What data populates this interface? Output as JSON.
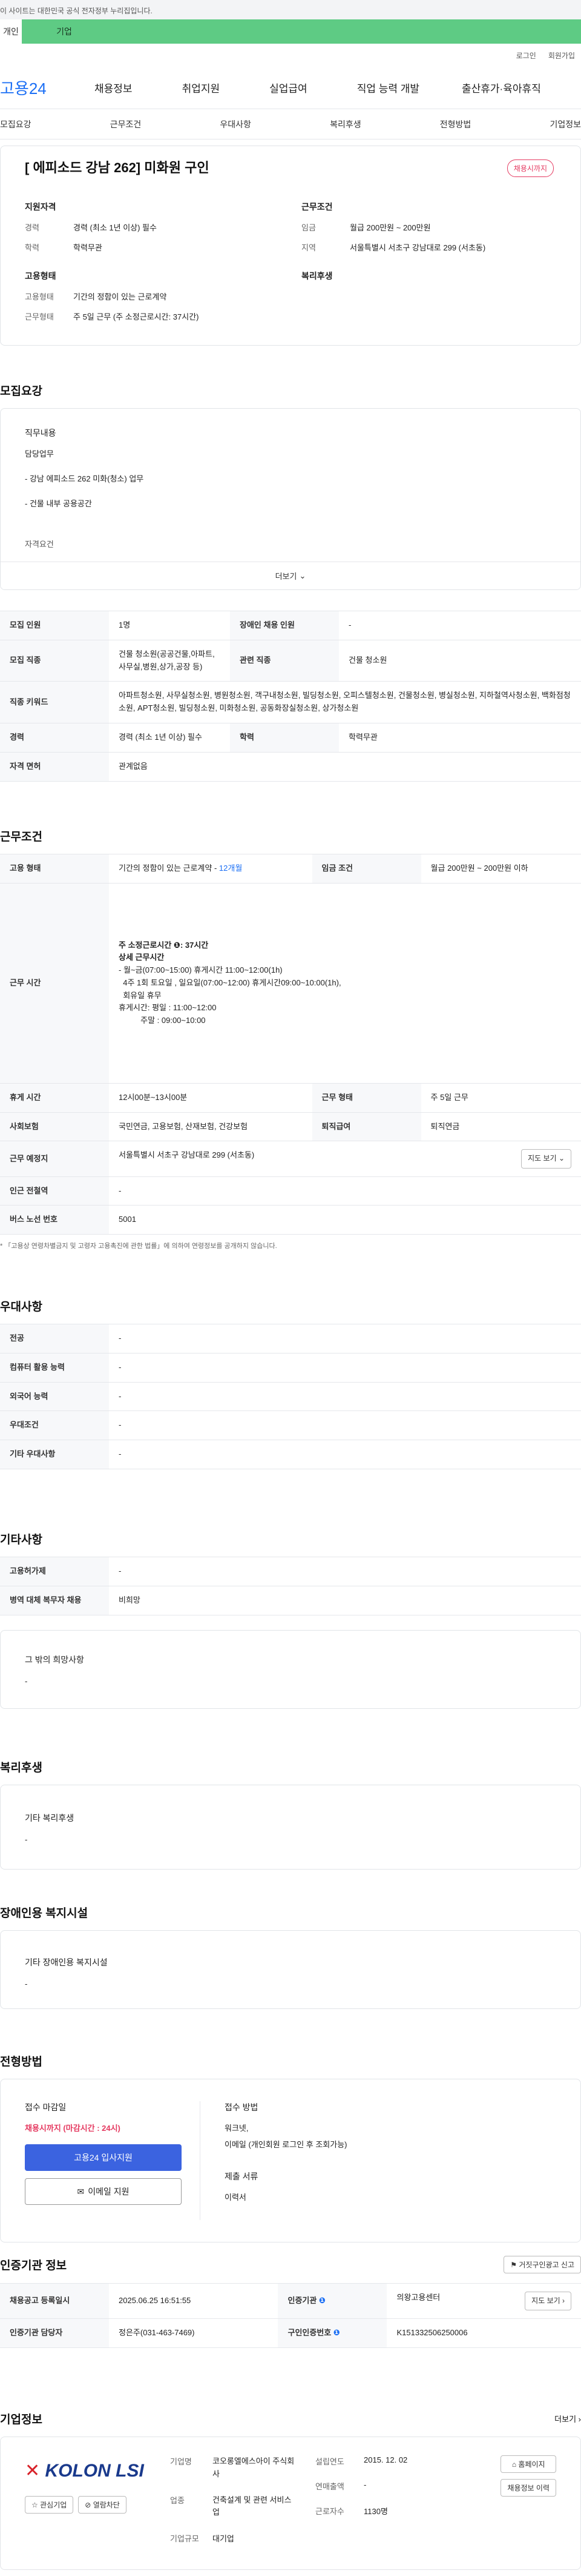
{
  "notice": "이 사이트는 대한민국 공식 전자정부 누리집입니다.",
  "tabs": [
    "개인",
    "기업"
  ],
  "util": [
    "로그인",
    "회원가입"
  ],
  "logo": "고용24",
  "gnb": [
    "채용정보",
    "취업지원",
    "실업급여",
    "직업 능력 개발",
    "출산휴가·육아휴직"
  ],
  "subnav": [
    "모집요강",
    "근무조건",
    "우대사항",
    "복리후생",
    "전형방법",
    "기업정보"
  ],
  "header": {
    "title": "[ 에피소드 강남 262] 미화원 구인",
    "badge": "채용시까지",
    "qual_title": "지원자격",
    "qual": [
      {
        "k": "경력",
        "v": "경력 (최소 1년 이상) 필수"
      },
      {
        "k": "학력",
        "v": "학력무관"
      }
    ],
    "cond_title": "근무조건",
    "cond": [
      {
        "k": "임금",
        "v": "월급 200만원 ~ 200만원"
      },
      {
        "k": "지역",
        "v": "서울특별시 서초구 강남대로 299 (서초동)"
      }
    ],
    "emp_title": "고용형태",
    "emp": [
      {
        "k": "고용형태",
        "v": "기간의 정함이 있는 근로계약"
      },
      {
        "k": "근무형태",
        "v": "주 5일 근무 (주 소정근로시간: 37시간)"
      }
    ],
    "welfare_title": "복리후생"
  },
  "recruit": {
    "title": "모집요강",
    "duty_title": "직무내용",
    "duty_sub": "담당업무",
    "duty_lines": [
      "- 강남 에피소드 262 미화(청소) 업무",
      "- 건물 내부 공용공간"
    ],
    "qual_cut": "자격요건",
    "more": "더보기",
    "rows": [
      {
        "k1": "모집 인원",
        "v1": "1명",
        "k2": "장애인 채용 인원",
        "v2": "-"
      },
      {
        "k1": "모집 직종",
        "v1": "건물 청소원(공공건물,아파트,사무실,병원,상가,공장 등)",
        "k2": "관련 직종",
        "v2": "건물 청소원"
      },
      {
        "k1": "직종 키워드",
        "v1": "아파트청소원, 사무실청소원, 병원청소원, 객구내청소원, 빌딩청소원, 오피스텔청소원, 건물청소원, 병실청소원, 지하철역사청소원, 백화점청소원, APT청소원, 빌딩청소원, 미화청소원, 공동화장실청소원, 상가청소원"
      },
      {
        "k1": "경력",
        "v1": "경력 (최소 1년 이상) 필수",
        "k2": "학력",
        "v2": "학력무관"
      },
      {
        "k1": "자격 면허",
        "v1": "관계없음"
      }
    ]
  },
  "work": {
    "title": "근무조건",
    "rows": [
      {
        "k1": "고용 형태",
        "v1": "기간의 정함이 있는 근로계약 - ",
        "v1b": "12개월",
        "k2": "임금 조건",
        "v2": "월급 200만원 ~ 200만원 이하"
      },
      {
        "k1": "근무 시간",
        "lines": [
          "주 소정근로시간 ❶: 37시간",
          "",
          "상세 근무시간",
          "- 월~금(07:00~15:00) 휴게시간 11:00~12:00(1h)",
          "  4주 1회 토요일 , 일요일(07:00~12:00) 휴게시간09:00~10:00(1h),",
          "  회유일 휴무",
          "",
          "휴게시간: 평일 : 11:00~12:00",
          "          주말 : 09:00~10:00"
        ]
      },
      {
        "k1": "휴게 시간",
        "v1": "12시00분~13시00분",
        "k2": "근무 형태",
        "v2": "주 5일 근무"
      },
      {
        "k1": "사회보험",
        "v1": "국민연금, 고용보험, 산재보험, 건강보험",
        "k2": "퇴직급여",
        "v2": "퇴직연금"
      },
      {
        "k1": "근무 예정지",
        "v1": "서울특별시 서초구 강남대로 299 (서초동)",
        "btn": "지도 보기"
      },
      {
        "k1": "인근 전철역",
        "v1": "-"
      },
      {
        "k1": "버스 노선 번호",
        "v1": "5001"
      }
    ],
    "footnote": "* 「고용상 연령차별금지 및 고령자 고용촉진에 관한 법률」에 의하여 연령정보를 공개하지 않습니다."
  },
  "pref": {
    "title": "우대사항",
    "rows": [
      {
        "k": "전공",
        "v": "-"
      },
      {
        "k": "컴퓨터 활용 능력",
        "v": "-"
      },
      {
        "k": "외국어 능력",
        "v": "-"
      },
      {
        "k": "우대조건",
        "v": "-"
      },
      {
        "k": "기타 우대사항",
        "v": "-"
      }
    ]
  },
  "etc": {
    "title": "기타사항",
    "rows": [
      {
        "k": "고용허가제",
        "v": "-"
      },
      {
        "k": "병역 대체 복무자 채용",
        "v": "비희망"
      }
    ],
    "hope_title": "그 밖의 희망사항",
    "hope_value": "-"
  },
  "welfare": {
    "title": "복리후생",
    "sub": "기타 복리후생",
    "value": "-"
  },
  "disab": {
    "title": "장애인용 복지시설",
    "sub": "기타 장애인용 복지시설",
    "value": "-"
  },
  "proc": {
    "title": "전형방법",
    "deadline_label": "접수 마감일",
    "deadline_value": "채용시까지 (마감시간 : 24시)",
    "apply_btn": "고용24 입사지원",
    "email_btn": "이메일 지원",
    "method_label": "접수 방법",
    "method_lines": [
      "워크넷,",
      "이메일 (개인회원 로그인 후 조회가능)"
    ],
    "docs_label": "제출 서류",
    "docs_value": "이력서"
  },
  "agency": {
    "title": "인증기관 정보",
    "report_btn": "거짓구인광고 신고",
    "rows": [
      {
        "k1": "채용공고 등록일시",
        "v1": "2025.06.25 16:51:55",
        "k2": "인증기관",
        "v2": "의왕고용센터",
        "btn": "지도 보기"
      },
      {
        "k1": "인증기관 담당자",
        "v1": "정은주(031-463-7469)",
        "k2": "구인인증번호",
        "v2": "K151332506250006"
      }
    ]
  },
  "company": {
    "title": "기업정보",
    "more": "더보기",
    "logo": "KOLON LSI",
    "interest_btn": "관심기업",
    "block_btn": "열람차단",
    "fields": [
      {
        "k": "기업명",
        "v": "코오롱엘에스아이 주식회사"
      },
      {
        "k": "업종",
        "v": "건축설계 및 관련 서비스업"
      },
      {
        "k": "기업규모",
        "v": "대기업"
      }
    ],
    "fields2": [
      {
        "k": "설립연도",
        "v": "2015. 12. 02"
      },
      {
        "k": "연매출액",
        "v": "-"
      },
      {
        "k": "근로자수",
        "v": "1130명"
      }
    ],
    "home_btn": "홈페이지",
    "history_btn": "채용정보 이력"
  },
  "colors": {
    "brand": "#1b6ff5",
    "accent": "#e53960",
    "tab": "#5ecb84"
  }
}
